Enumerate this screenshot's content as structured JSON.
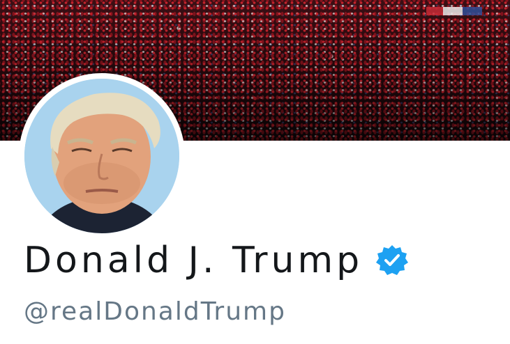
{
  "profile": {
    "display_name": "Donald J. Trump",
    "handle": "@realDonaldTrump",
    "verified": true
  },
  "icons": {
    "verified": "verified-badge-icon"
  },
  "colors": {
    "name_text": "#14171a",
    "handle_text": "#657786",
    "verified_blue": "#1da1f2",
    "background": "#ffffff"
  }
}
